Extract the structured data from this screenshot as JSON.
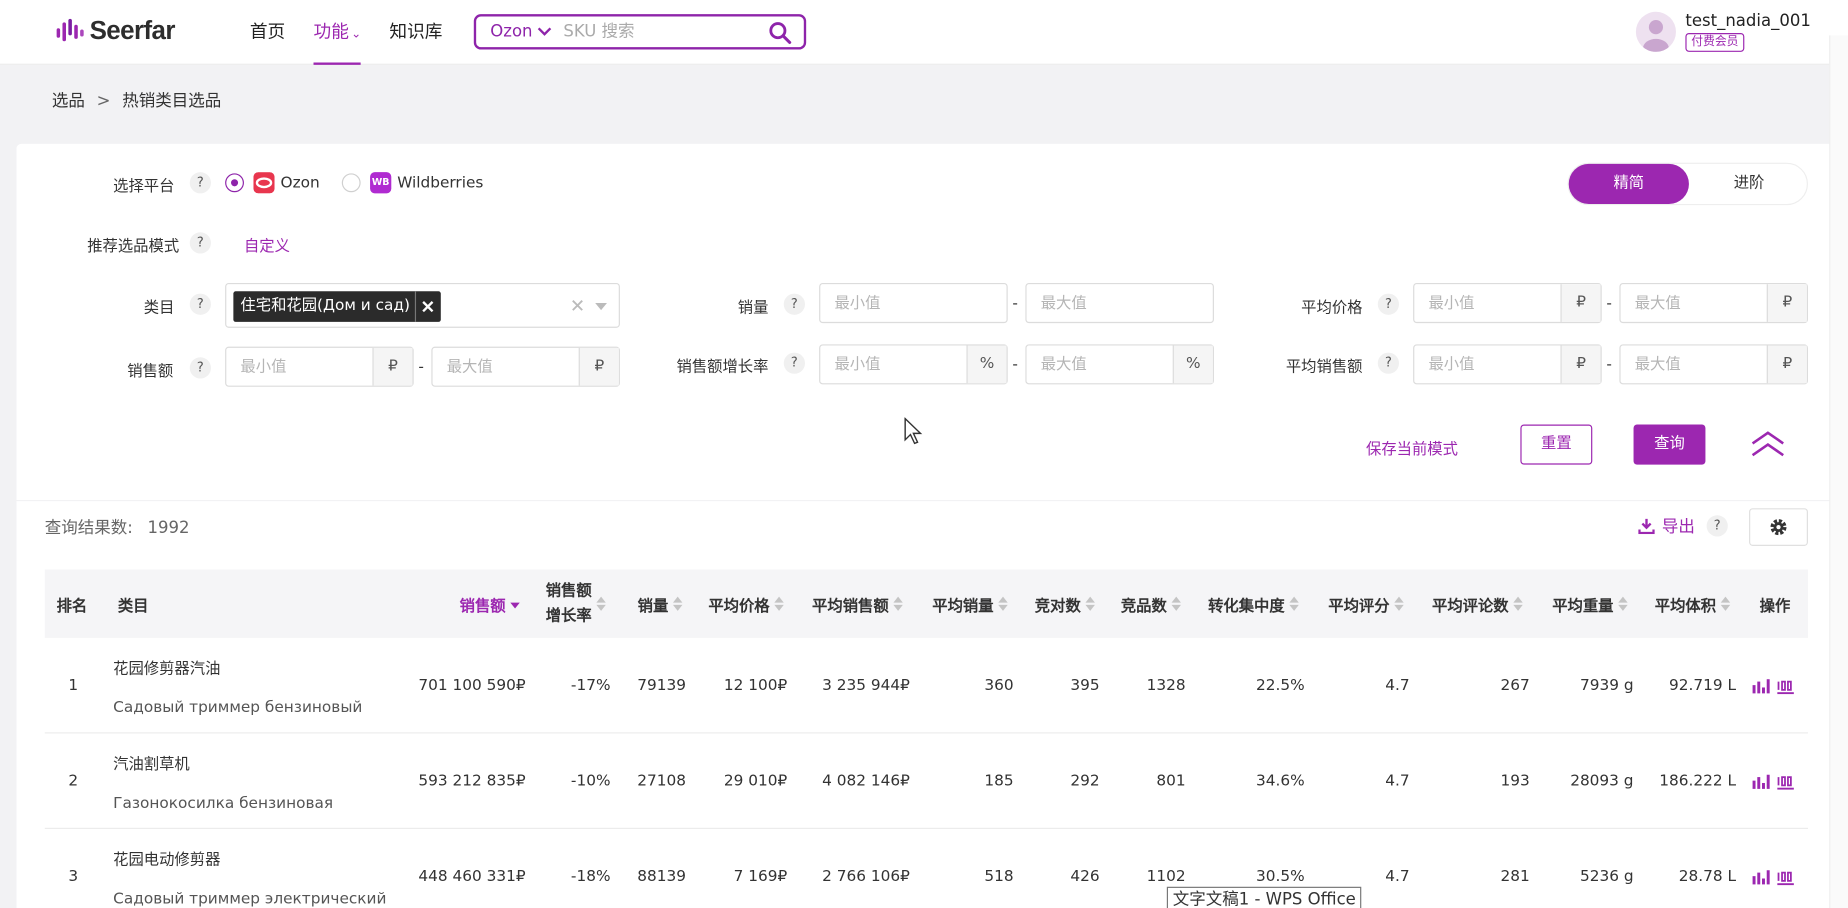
{
  "header": {
    "logo_text": "Seerfar",
    "nav": [
      {
        "label": "首页"
      },
      {
        "label": "功能",
        "active": true,
        "caret": "⌄"
      },
      {
        "label": "知识库"
      }
    ],
    "search": {
      "platform": "Ozon",
      "placeholder": "SKU 搜索"
    },
    "user": {
      "name": "test_nadia_001",
      "badge": "付费会员"
    }
  },
  "breadcrumb": {
    "parent": "选品",
    "sep": ">",
    "current": "热销类目选品"
  },
  "filters": {
    "platform_label": "选择平台",
    "platforms": [
      {
        "name": "Ozon",
        "checked": true,
        "icon_text": ""
      },
      {
        "name": "Wildberries",
        "checked": false,
        "icon_text": "WB"
      }
    ],
    "mode_label": "推荐选品模式",
    "mode_link": "自定义",
    "mode_toggle": {
      "basic": "精简",
      "advanced": "进阶"
    },
    "category_label": "类目",
    "category_tag": "住宅和花园(Дом и сад)",
    "sales_volume_label": "销量",
    "avg_price_label": "平均价格",
    "sales_amount_label": "销售额",
    "growth_label": "销售额增长率",
    "avg_sales_label": "平均销售额",
    "min_placeholder": "最小值",
    "max_placeholder": "最大值",
    "help": "?",
    "dash": "-",
    "ruble": "₽",
    "percent": "%",
    "save_mode": "保存当前模式",
    "reset": "重置",
    "query": "查询"
  },
  "results": {
    "count_label": "查询结果数:",
    "count": "1992",
    "export": "导出",
    "columns": {
      "rank": "排名",
      "category": "类目",
      "sales": "销售额",
      "growth_1": "销售额",
      "growth_2": "增长率",
      "volume": "销量",
      "avg_price": "平均价格",
      "avg_sales": "平均销售额",
      "avg_volume": "平均销量",
      "competitors": "竞对数",
      "products": "竞品数",
      "concentration": "转化集中度",
      "avg_rating": "平均评分",
      "avg_reviews": "平均评论数",
      "avg_weight": "平均重量",
      "avg_volume_l": "平均体积",
      "ops": "操作"
    },
    "rows": [
      {
        "rank": "1",
        "cn": "花园修剪器汽油",
        "ru": "Садовый триммер бензиновый",
        "sales": "701 100 590₽",
        "growth": "-17%",
        "volume": "79139",
        "avg_price": "12 100₽",
        "avg_sales": "3 235 944₽",
        "avg_volume": "360",
        "competitors": "395",
        "products": "1328",
        "concentration": "22.5%",
        "rating": "4.7",
        "reviews": "267",
        "weight": "7939 g",
        "vol": "92.719 L"
      },
      {
        "rank": "2",
        "cn": "汽油割草机",
        "ru": "Газонокосилка бензиновая",
        "sales": "593 212 835₽",
        "growth": "-10%",
        "volume": "27108",
        "avg_price": "29 010₽",
        "avg_sales": "4 082 146₽",
        "avg_volume": "185",
        "competitors": "292",
        "products": "801",
        "concentration": "34.6%",
        "rating": "4.7",
        "reviews": "193",
        "weight": "28093 g",
        "vol": "186.222 L"
      },
      {
        "rank": "3",
        "cn": "花园电动修剪器",
        "ru": "Садовый триммер электрический",
        "sales": "448 460 331₽",
        "growth": "-18%",
        "volume": "88139",
        "avg_price": "7 169₽",
        "avg_sales": "2 766 106₽",
        "avg_volume": "518",
        "competitors": "426",
        "products": "1102",
        "concentration": "30.5%",
        "rating": "4.7",
        "reviews": "281",
        "weight": "5236 g",
        "vol": "28.78 L"
      }
    ]
  },
  "taskbar_tip": "文字文稿1 - WPS Office",
  "colors": {
    "accent": "#9c27b0",
    "header_bg": "#ffffff",
    "page_bg": "#f2f2f4"
  }
}
